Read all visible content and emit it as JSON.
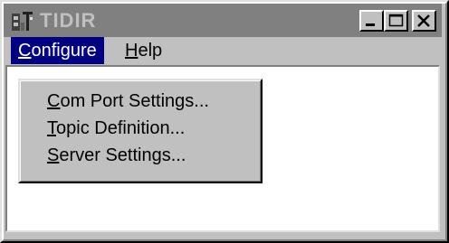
{
  "window": {
    "title": "TIDIR",
    "app_icon": "tidir-app-icon",
    "controls": {
      "minimize_icon": "minimize-icon",
      "maximize_icon": "maximize-icon",
      "close_icon": "close-icon"
    }
  },
  "menubar": {
    "items": [
      {
        "accel": "C",
        "rest": "onfigure",
        "active": true
      },
      {
        "accel": "H",
        "rest": "elp",
        "active": false
      }
    ]
  },
  "dropdown": {
    "items": [
      {
        "accel": "C",
        "rest": "om Port Settings..."
      },
      {
        "accel": "T",
        "rest": "opic Definition..."
      },
      {
        "accel": "S",
        "rest": "erver Settings..."
      }
    ]
  },
  "colors": {
    "titlebar_inactive": "#808080",
    "menu_highlight": "#000080",
    "face": "#c0c0c0"
  }
}
